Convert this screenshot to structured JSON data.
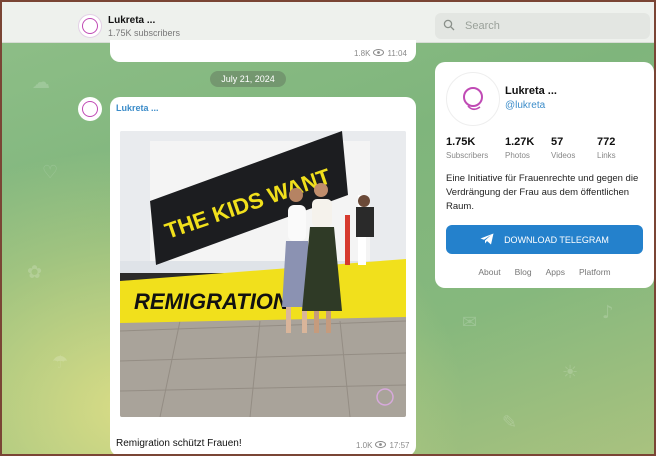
{
  "header": {
    "channel_name": "Lukreta ...",
    "subscribers": "1.75K subscribers",
    "search_placeholder": "Search"
  },
  "previous_post": {
    "views": "1.8K",
    "time": "11:04"
  },
  "date_separator": "July 21, 2024",
  "post": {
    "author": "Lukreta ...",
    "caption": "Remigration schützt Frauen!",
    "views": "1.0K",
    "time": "17:57",
    "banner_top": "THE KIDS WANT",
    "banner_bottom": "REMIGRATION"
  },
  "channel_card": {
    "name": "Lukreta ...",
    "handle": "@lukreta",
    "stats": [
      {
        "value": "1.75K",
        "label": "Subscribers"
      },
      {
        "value": "1.27K",
        "label": "Photos"
      },
      {
        "value": "57",
        "label": "Videos"
      },
      {
        "value": "772",
        "label": "Links"
      }
    ],
    "description": "Eine Initiative für Frauenrechte und gegen die Verdrängung der Frau aus dem öffentlichen Raum.",
    "download_label": "DOWNLOAD TELEGRAM",
    "footer_links": [
      "About",
      "Blog",
      "Apps",
      "Platform"
    ]
  },
  "colors": {
    "accent": "#2481cc",
    "banner_yellow": "#f1e01c",
    "logo_pink": "#c04bb5"
  }
}
